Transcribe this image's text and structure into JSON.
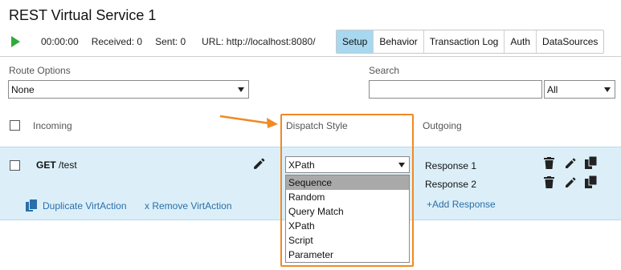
{
  "window": {
    "title": "REST Virtual Service 1"
  },
  "status": {
    "time": "00:00:00",
    "received": "Received: 0",
    "sent": "Sent: 0",
    "url": "URL: http://localhost:8080/"
  },
  "tabs": [
    {
      "label": "Setup",
      "active": true
    },
    {
      "label": "Behavior",
      "active": false
    },
    {
      "label": "Transaction Log",
      "active": false
    },
    {
      "label": "Auth",
      "active": false
    },
    {
      "label": "DataSources",
      "active": false
    }
  ],
  "filters": {
    "route_options_label": "Route Options",
    "route_options_value": "None",
    "search_label": "Search",
    "search_value": "",
    "search_scope_value": "All"
  },
  "columns": {
    "incoming": "Incoming",
    "dispatch_style": "Dispatch Style",
    "outgoing": "Outgoing"
  },
  "virt_action": {
    "method": "GET",
    "path": "/test",
    "duplicate_label": "Duplicate VirtAction",
    "remove_label": "x Remove VirtAction",
    "dispatch_value": "XPath",
    "dispatch_options": [
      "Sequence",
      "Random",
      "Query Match",
      "XPath",
      "Script",
      "Parameter"
    ],
    "highlighted_option": "Sequence",
    "responses": [
      "Response 1",
      "Response 2"
    ],
    "add_response_label": "+Add Response"
  },
  "colors": {
    "accent_tab": "#a8d8ef",
    "row_bg": "#dceff9",
    "link": "#2a6fa8",
    "annotation": "#f08a24",
    "play": "#2eab3a"
  },
  "icons": [
    "play-icon",
    "pencil-icon",
    "trash-icon",
    "duplicate-icon",
    "chevron-down-icon",
    "annotation-arrow"
  ]
}
